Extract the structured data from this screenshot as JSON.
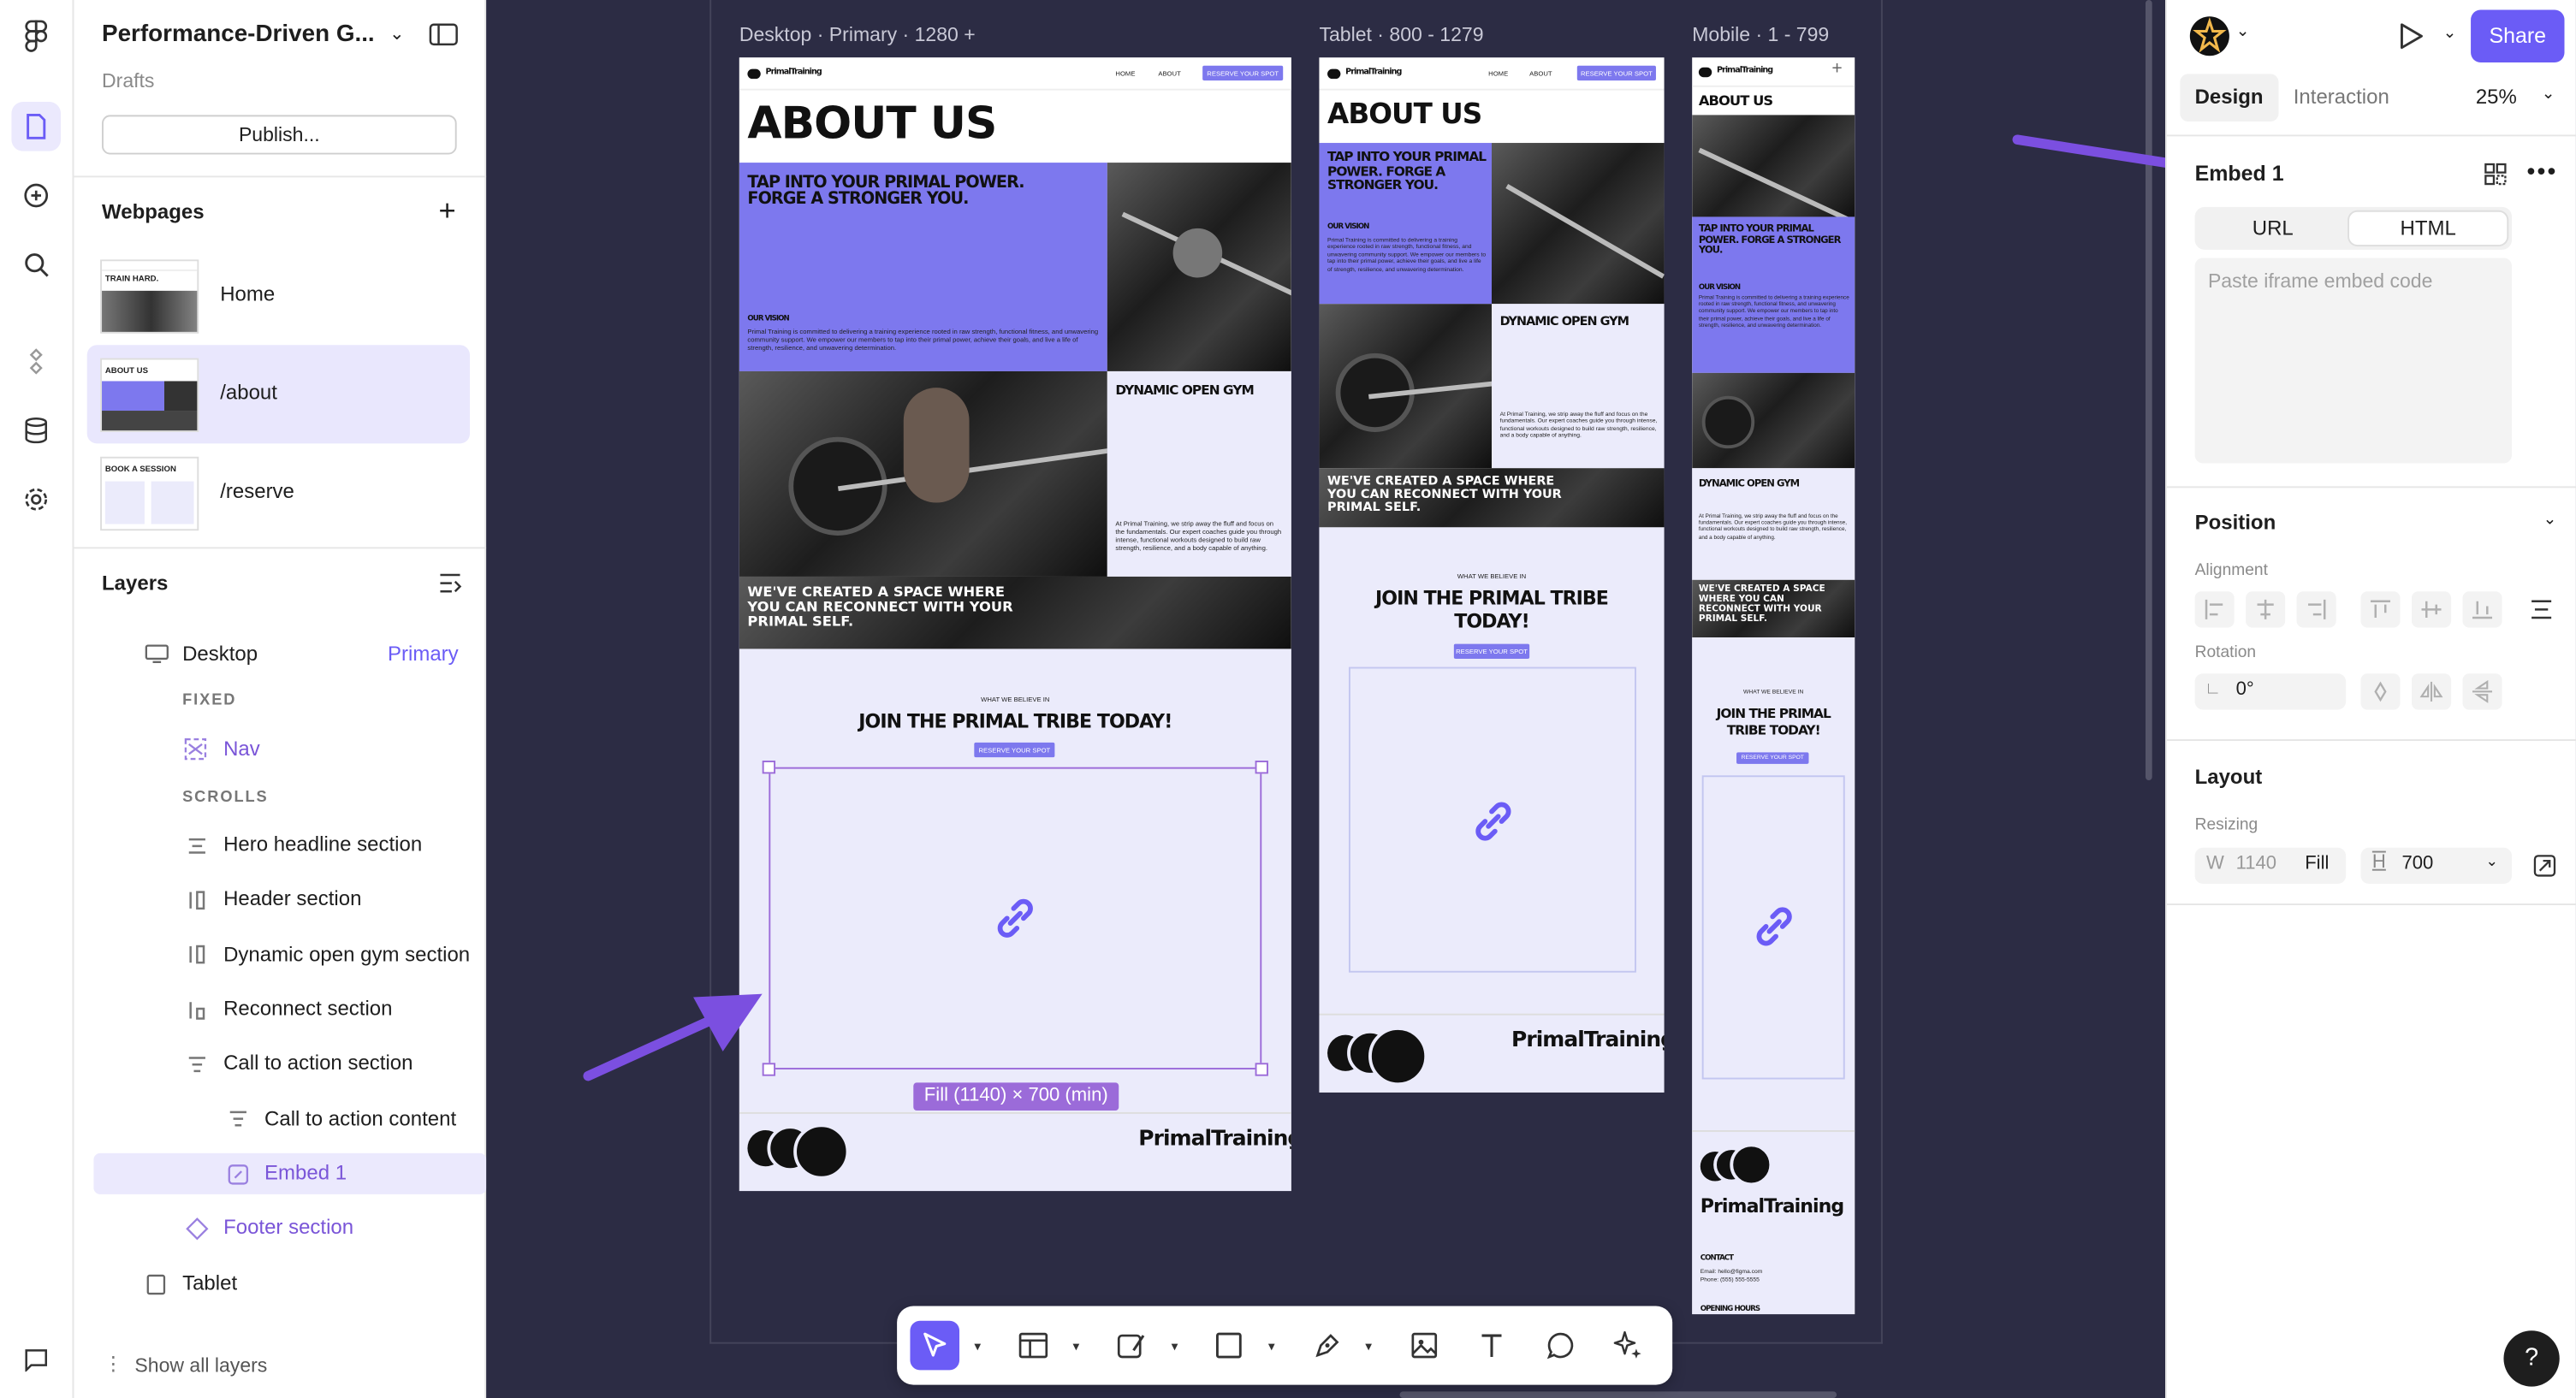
{
  "project": {
    "title": "Performance-Driven G...",
    "subtitle": "Drafts",
    "publish_label": "Publish..."
  },
  "webpages": {
    "title": "Webpages",
    "items": [
      {
        "label": "Home"
      },
      {
        "label": "/about"
      },
      {
        "label": "/reserve"
      }
    ]
  },
  "layers": {
    "title": "Layers",
    "desktop": "Desktop",
    "desktop_tag": "Primary",
    "fixed": "FIXED",
    "nav": "Nav",
    "scrolls": "SCROLLS",
    "items": [
      "Hero headline section",
      "Header section",
      "Dynamic open gym section",
      "Reconnect section",
      "Call to action section",
      "Call to action content",
      "Embed 1",
      "Footer section",
      "Tablet"
    ],
    "show_all": "Show all layers"
  },
  "canvas": {
    "desktop_label": "Desktop · Primary · 1280 +",
    "tablet_label": "Tablet · 800 - 1279",
    "mobile_label": "Mobile · 1 - 799",
    "brand": "PrimalTraining",
    "nav_home": "HOME",
    "nav_about": "ABOUT",
    "nav_cta": "RESERVE YOUR SPOT",
    "about_title": "ABOUT US",
    "tagline": "TAP INTO YOUR PRIMAL POWER. FORGE A STRONGER YOU.",
    "vision_head": "OUR VISION",
    "vision_text": "Primal Training is committed to delivering a training experience rooted in raw strength, functional fitness, and unwavering community support. We empower our members to tap into their primal power, achieve their goals, and live a life of strength, resilience, and unwavering determination.",
    "gym_head": "DYNAMIC OPEN GYM",
    "gym_text": "At Primal Training, we strip away the fluff and focus on the fundamentals. Our expert coaches guide you through intense, functional workouts designed to build raw strength, resilience, and a body capable of anything.",
    "reconnect": "WE'VE CREATED A SPACE WHERE YOU CAN RECONNECT WITH YOUR PRIMAL SELF.",
    "believe": "WHAT WE BELIEVE IN",
    "join": "JOIN THE PRIMAL TRIBE TODAY!",
    "cta": "RESERVE YOUR SPOT",
    "size_badge": "Fill (1140) × 700 (min)",
    "footer_brand": "PrimalTraining",
    "contact_head": "CONTACT",
    "contact_email": "Email: hello@figma.com",
    "contact_phone": "Phone: (555) 555-5555",
    "hours_head": "OPENING HOURS"
  },
  "right_panel": {
    "share": "Share",
    "tab_design": "Design",
    "tab_interaction": "Interaction",
    "zoom": "25%",
    "embed_title": "Embed 1",
    "seg_url": "URL",
    "seg_html": "HTML",
    "embed_placeholder": "Paste iframe embed code",
    "position": "Position",
    "alignment": "Alignment",
    "rotation": "Rotation",
    "rotation_value": "0°",
    "layout": "Layout",
    "resizing": "Resizing",
    "w_label": "W",
    "w_value": "1140",
    "w_mode": "Fill",
    "h_label": "H",
    "h_value": "700"
  },
  "help": "?",
  "colors": {
    "accent": "#6b5cf6",
    "brand_violet": "#7d78ee",
    "lavender": "#ebebfb",
    "canvas": "#2c2c44",
    "arrow": "#7b4fe0"
  }
}
